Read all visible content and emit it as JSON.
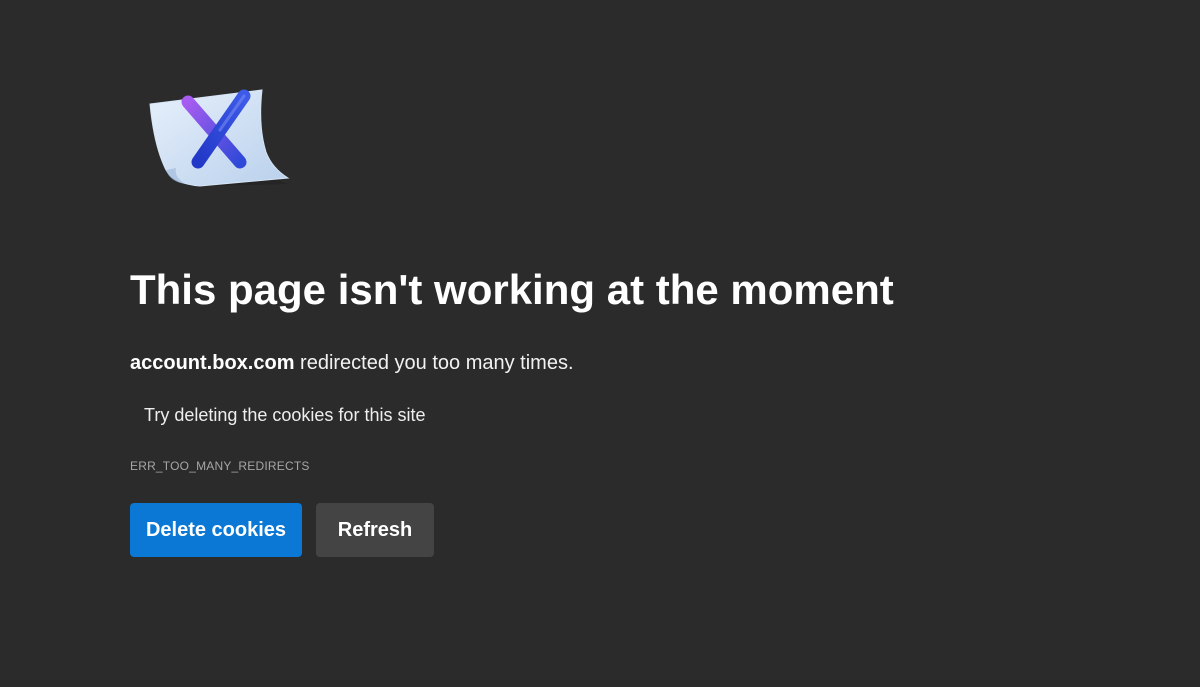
{
  "error": {
    "headline": "This page isn't working at the moment",
    "host": "account.box.com",
    "message_suffix": " redirected you too many times.",
    "suggestion": "Try deleting the cookies for this site",
    "code": "ERR_TOO_MANY_REDIRECTS"
  },
  "actions": {
    "delete_cookies_label": "Delete cookies",
    "refresh_label": "Refresh"
  },
  "icon": "error-document-x-icon",
  "colors": {
    "background": "#2b2b2b",
    "primary_button": "#0a78d4",
    "secondary_button": "#444444",
    "error_code_text": "#a6a6a6"
  }
}
